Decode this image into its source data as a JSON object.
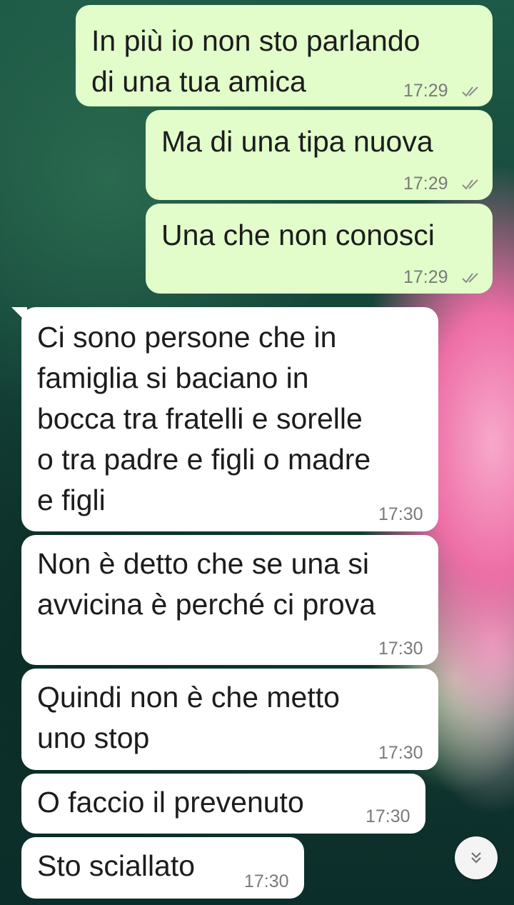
{
  "messages": [
    {
      "direction": "outgoing",
      "text": "In più io non sto parlando\ndi una tua amica",
      "time": "17:29",
      "status": "read"
    },
    {
      "direction": "outgoing",
      "text": "Ma di una tipa nuova",
      "time": "17:29",
      "status": "read"
    },
    {
      "direction": "outgoing",
      "text": "Una che non conosci",
      "time": "17:29",
      "status": "read"
    },
    {
      "direction": "incoming",
      "text": "Ci sono persone che in\nfamiglia si baciano in\nbocca tra fratelli e sorelle\no tra padre e figli o madre\ne figli",
      "time": "17:30"
    },
    {
      "direction": "incoming",
      "text": "Non è detto che se una si\navvicina è perché ci prova",
      "time": "17:30"
    },
    {
      "direction": "incoming",
      "text": "Quindi non è che metto\nuno stop",
      "time": "17:30"
    },
    {
      "direction": "incoming",
      "text": "O faccio il prevenuto",
      "time": "17:30"
    },
    {
      "direction": "incoming",
      "text": "Sto sciallato",
      "time": "17:30"
    }
  ],
  "icons": {
    "read_ticks": "double-check-icon",
    "scroll_down": "double-chevron-down-icon"
  },
  "colors": {
    "outgoing_bubble": "#e2fdca",
    "incoming_bubble": "#ffffff",
    "time_text": "#7a7a7a"
  }
}
